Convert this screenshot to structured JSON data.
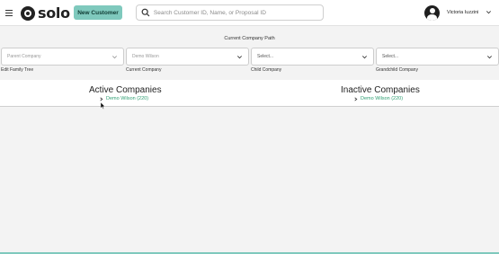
{
  "header": {
    "logo_text": "solo",
    "new_customer_label": "New Customer",
    "search_placeholder": "Search Customer ID, Name, or Proposal ID",
    "user_name": "Victoria Iuzzini"
  },
  "company_path": {
    "title": "Current Company Path",
    "selects": [
      {
        "value": "Parent Company",
        "label": "Edit Family Tree"
      },
      {
        "value": "Demo Wilson",
        "label": "Current Company"
      },
      {
        "value": "Select...",
        "label": "Child Company"
      },
      {
        "value": "Select...",
        "label": "Grandchild Company"
      }
    ]
  },
  "active": {
    "title": "Active Companies",
    "items": [
      {
        "label": "Demo Wilson (220)"
      }
    ]
  },
  "inactive": {
    "title": "Inactive Companies",
    "items": [
      {
        "label": "Demo Wilson (220)"
      }
    ]
  },
  "colors": {
    "accent": "#7fc9bd",
    "link": "#2e9e72"
  }
}
